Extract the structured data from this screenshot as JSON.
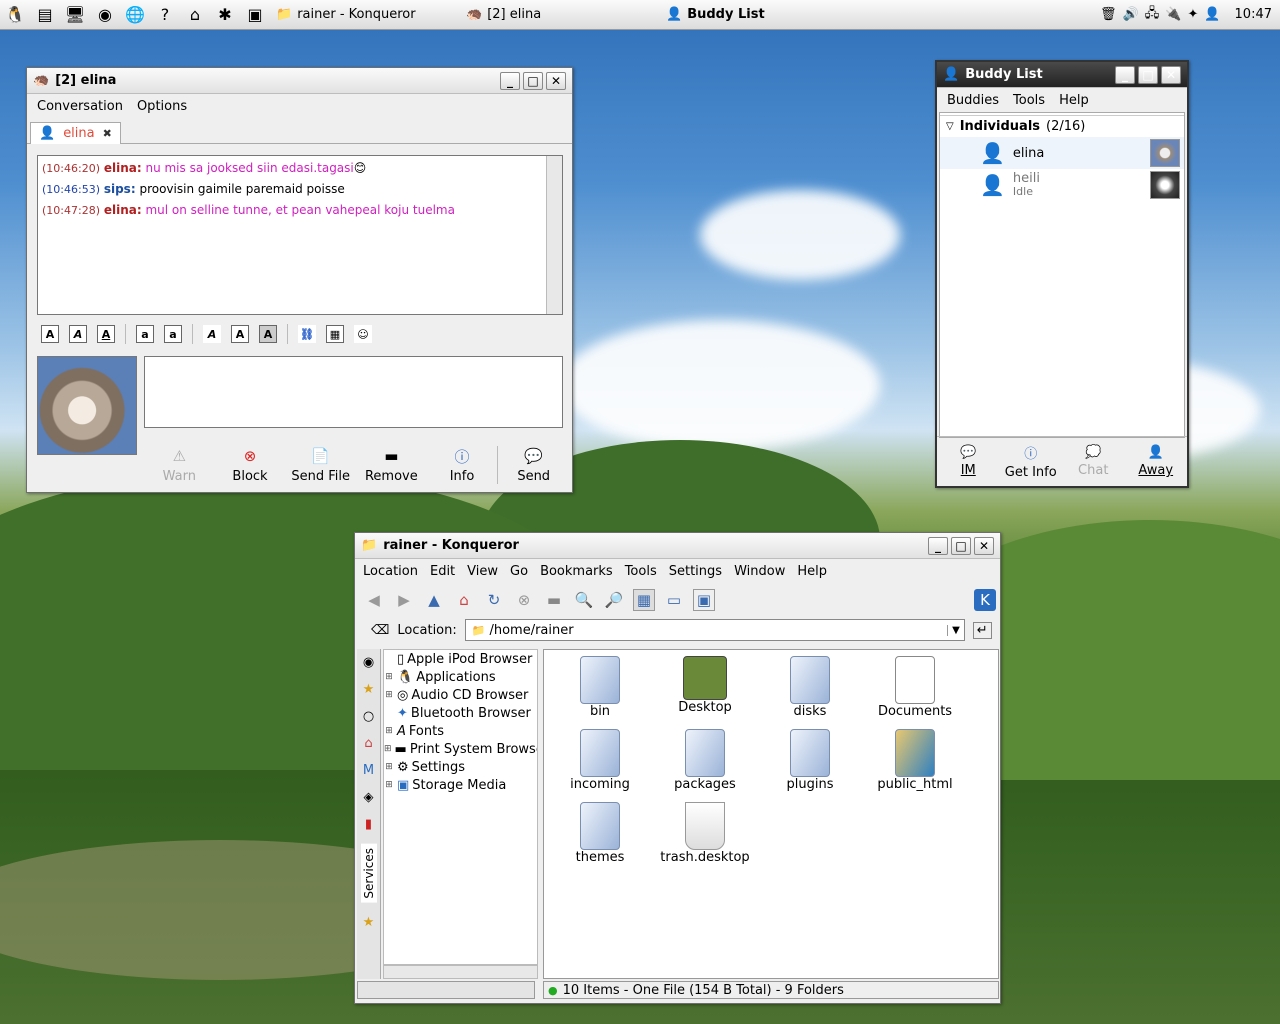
{
  "taskbar": {
    "tasks": [
      {
        "label": "rainer - Konqueror"
      },
      {
        "label": "[2] elina"
      },
      {
        "label": "Buddy List"
      }
    ],
    "clock": "10:47"
  },
  "chat_window": {
    "title": "[2] elina",
    "menu": [
      "Conversation",
      "Options"
    ],
    "tab_label": "elina",
    "messages": [
      {
        "time": "(10:46:20)",
        "name": "elina:",
        "text": "nu mis sa jooksed siin edasi.tagasi"
      },
      {
        "time": "(10:46:53)",
        "name": "sips:",
        "text": "proovisin gaimile paremaid poisse"
      },
      {
        "time": "(10:47:28)",
        "name": "elina:",
        "text": "mul on selline tunne, et pean vahepeal koju tuelma"
      }
    ],
    "buttons": [
      "Warn",
      "Block",
      "Send File",
      "Remove",
      "Info",
      "Send"
    ]
  },
  "buddy_list": {
    "title": "Buddy List",
    "menu": [
      "Buddies",
      "Tools",
      "Help"
    ],
    "group": "Individuals",
    "group_count": "(2/16)",
    "buddies": [
      {
        "name": "elina",
        "status": ""
      },
      {
        "name": "heili",
        "status": "Idle"
      }
    ],
    "buttons": [
      "IM",
      "Get Info",
      "Chat",
      "Away"
    ]
  },
  "konqueror": {
    "title": "rainer - Konqueror",
    "menu": [
      "Location",
      "Edit",
      "View",
      "Go",
      "Bookmarks",
      "Tools",
      "Settings",
      "Window",
      "Help"
    ],
    "location_label": "Location:",
    "location_value": "/home/rainer",
    "sidebar_label": "Services",
    "tree": [
      {
        "label": "Apple iPod Browser",
        "expandable": false
      },
      {
        "label": "Applications",
        "expandable": true
      },
      {
        "label": "Audio CD Browser",
        "expandable": true
      },
      {
        "label": "Bluetooth Browser",
        "expandable": false
      },
      {
        "label": "Fonts",
        "expandable": true
      },
      {
        "label": "Print System Browse",
        "expandable": true
      },
      {
        "label": "Settings",
        "expandable": true
      },
      {
        "label": "Storage Media",
        "expandable": true
      }
    ],
    "files": [
      {
        "name": "bin",
        "kind": "folder"
      },
      {
        "name": "Desktop",
        "kind": "desktop"
      },
      {
        "name": "disks",
        "kind": "folder"
      },
      {
        "name": "Documents",
        "kind": "document"
      },
      {
        "name": "incoming",
        "kind": "folder"
      },
      {
        "name": "packages",
        "kind": "folder"
      },
      {
        "name": "plugins",
        "kind": "folder"
      },
      {
        "name": "public_html",
        "kind": "web-folder"
      },
      {
        "name": "themes",
        "kind": "folder"
      },
      {
        "name": "trash.desktop",
        "kind": "trash"
      }
    ],
    "status": "10 Items - One File (154 B Total) - 9 Folders"
  }
}
